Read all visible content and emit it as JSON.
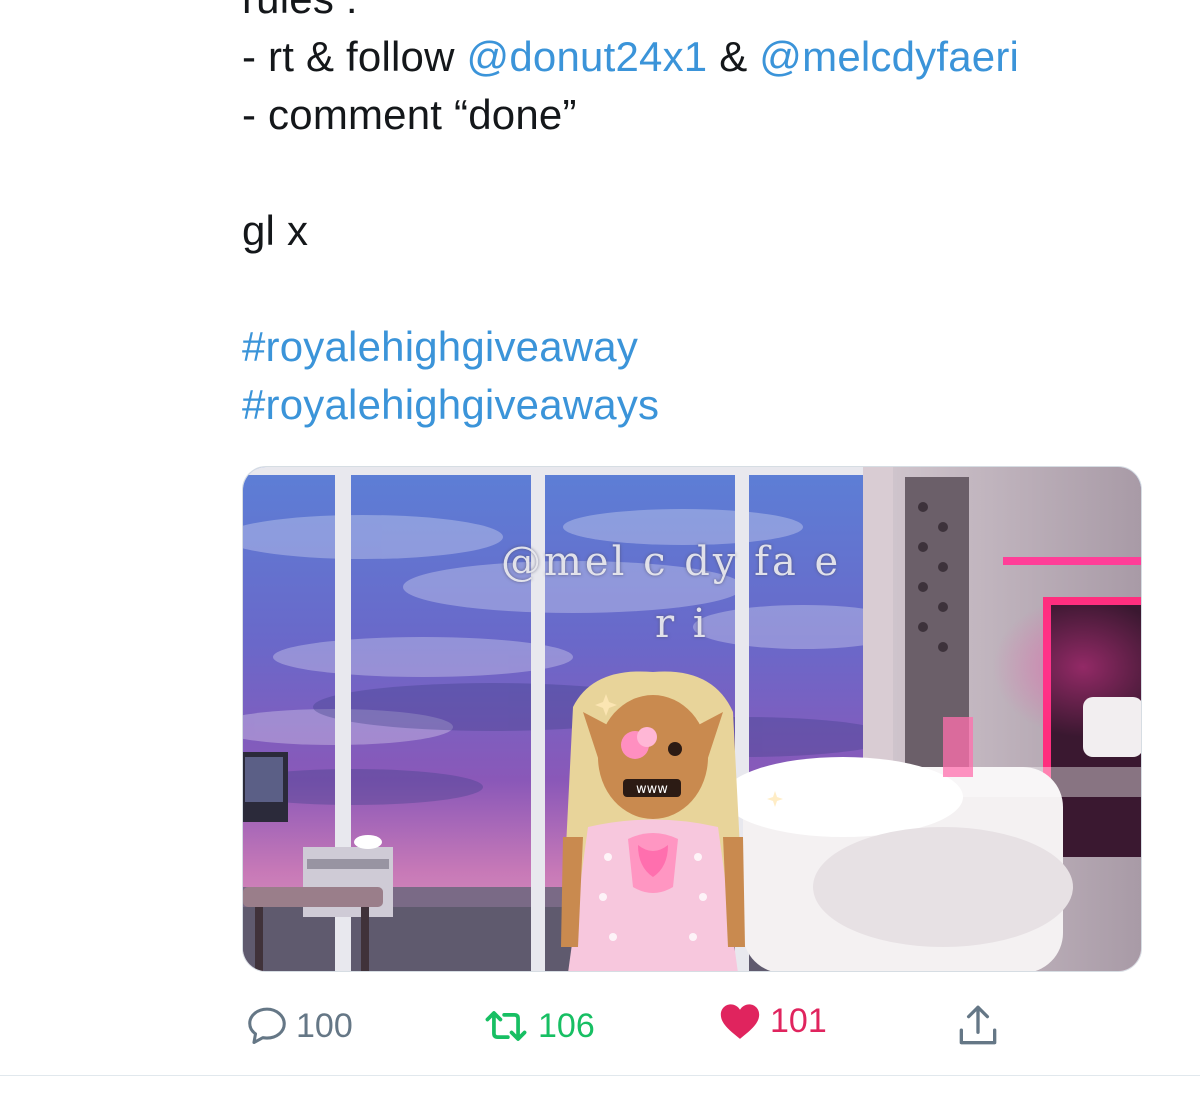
{
  "tweet": {
    "text_lines": {
      "rules": "rules :",
      "rule1_prefix": "- rt & follow ",
      "rule1_mention1": "@donut24x1",
      "rule1_amp": " & ",
      "rule1_mention2": "@melcdyfaeri",
      "rule2": "- comment “done”",
      "closing": "gl x",
      "hashtag1": "#royalehighgiveaway",
      "hashtag2": "#royalehighgiveaways"
    },
    "media": {
      "watermark_line1": "@mel c dy fa e",
      "watermark_line2": "r i",
      "face_text": "www"
    },
    "actions": {
      "reply": {
        "icon": "speech-bubble-icon",
        "count": "100"
      },
      "retweet": {
        "icon": "retweet-arrows-icon",
        "count": "106",
        "color": "#17bf63"
      },
      "like": {
        "icon": "heart-icon",
        "count": "101",
        "color": "#e0245e"
      },
      "share": {
        "icon": "share-upload-icon"
      }
    },
    "link_color": "#3b94d9"
  }
}
